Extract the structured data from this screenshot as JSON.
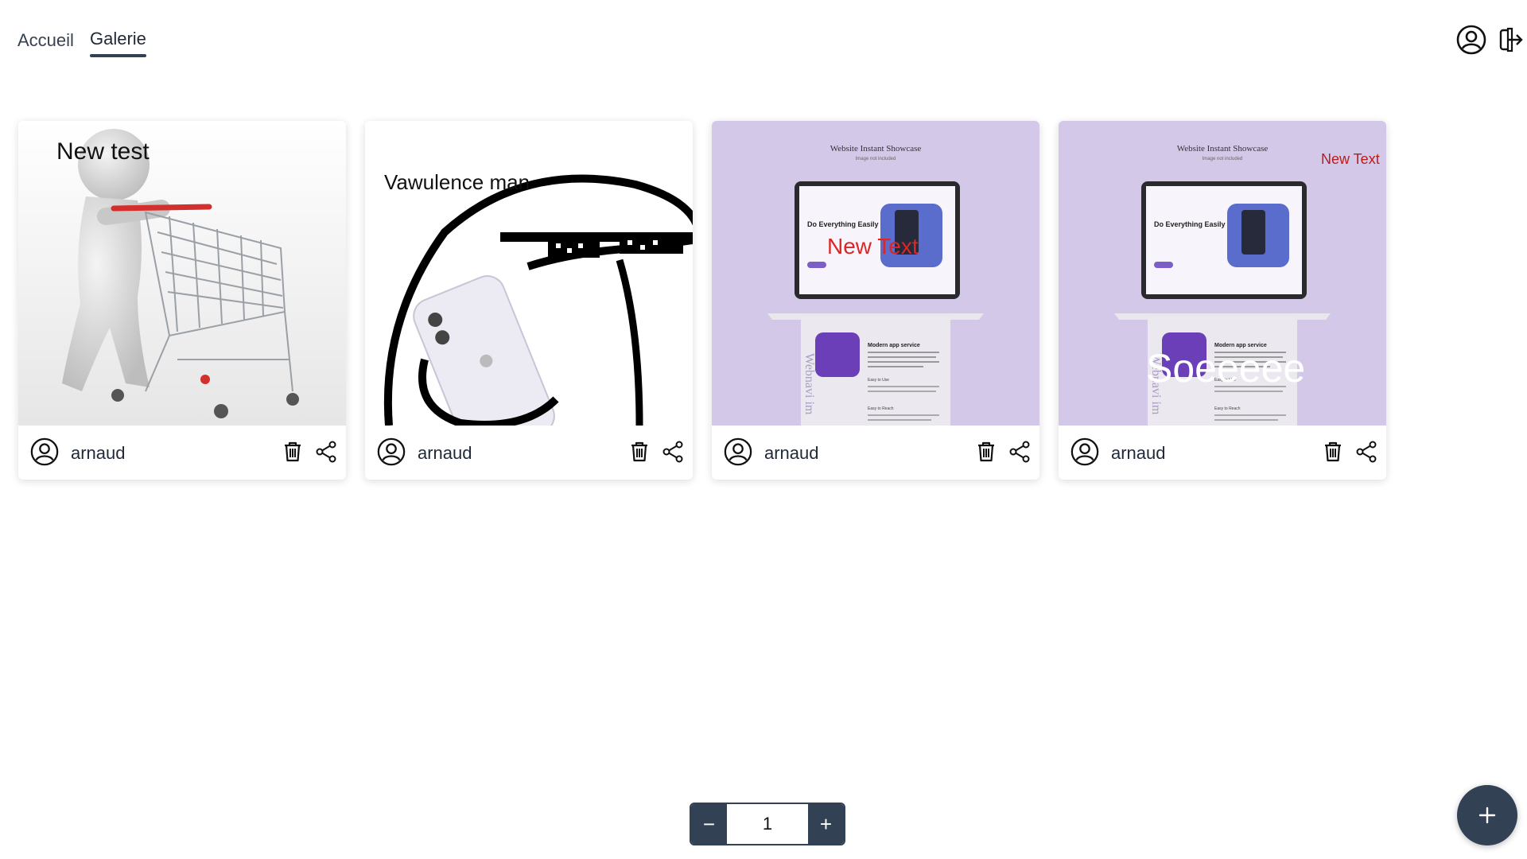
{
  "nav": {
    "links": [
      {
        "label": "Accueil",
        "active": false
      },
      {
        "label": "Galerie",
        "active": true
      }
    ],
    "profile_icon": "user-circle-icon",
    "logout_icon": "logout-icon"
  },
  "gallery": {
    "cards": [
      {
        "image": "shopping-cart-figure",
        "overlay_text": "New test",
        "overlay_color": "#111111",
        "author": "arnaud"
      },
      {
        "image": "meme-sunglasses-phone",
        "overlay_text": "Vawulence man",
        "overlay_color": "#111111",
        "author": "arnaud"
      },
      {
        "image": "website-showcase-mockup",
        "overlay_text": "New Text",
        "overlay_color": "#dc2626",
        "author": "arnaud",
        "image_texts": {
          "header": "Website Instant Showcase",
          "subheader": "Image not included",
          "hero": "Do Everything Easily",
          "section": "Modern app service",
          "item1": "Easy to Use",
          "item2": "Easy to Reach",
          "side": "Webnavi im"
        }
      },
      {
        "image": "website-showcase-mockup",
        "overlay_text": "Soeeeee",
        "overlay_color": "#ffffff",
        "corner_text": "New Text",
        "corner_color": "#b91c1c",
        "author": "arnaud",
        "image_texts": {
          "header": "Website Instant Showcase",
          "subheader": "Image not included",
          "hero": "Do Everything Easily",
          "section": "Modern app service",
          "item1": "Easy to Use",
          "item2": "Easy to Reach",
          "side": "Webnavi im"
        }
      }
    ],
    "delete_icon": "trash-icon",
    "share_icon": "share-icon",
    "avatar_icon": "user-circle-icon"
  },
  "pagination": {
    "decrement_label": "−",
    "page": "1",
    "increment_label": "+"
  },
  "fab": {
    "label": "+"
  },
  "colors": {
    "primary": "#334155",
    "mockup_bg": "#d4c8e8"
  }
}
